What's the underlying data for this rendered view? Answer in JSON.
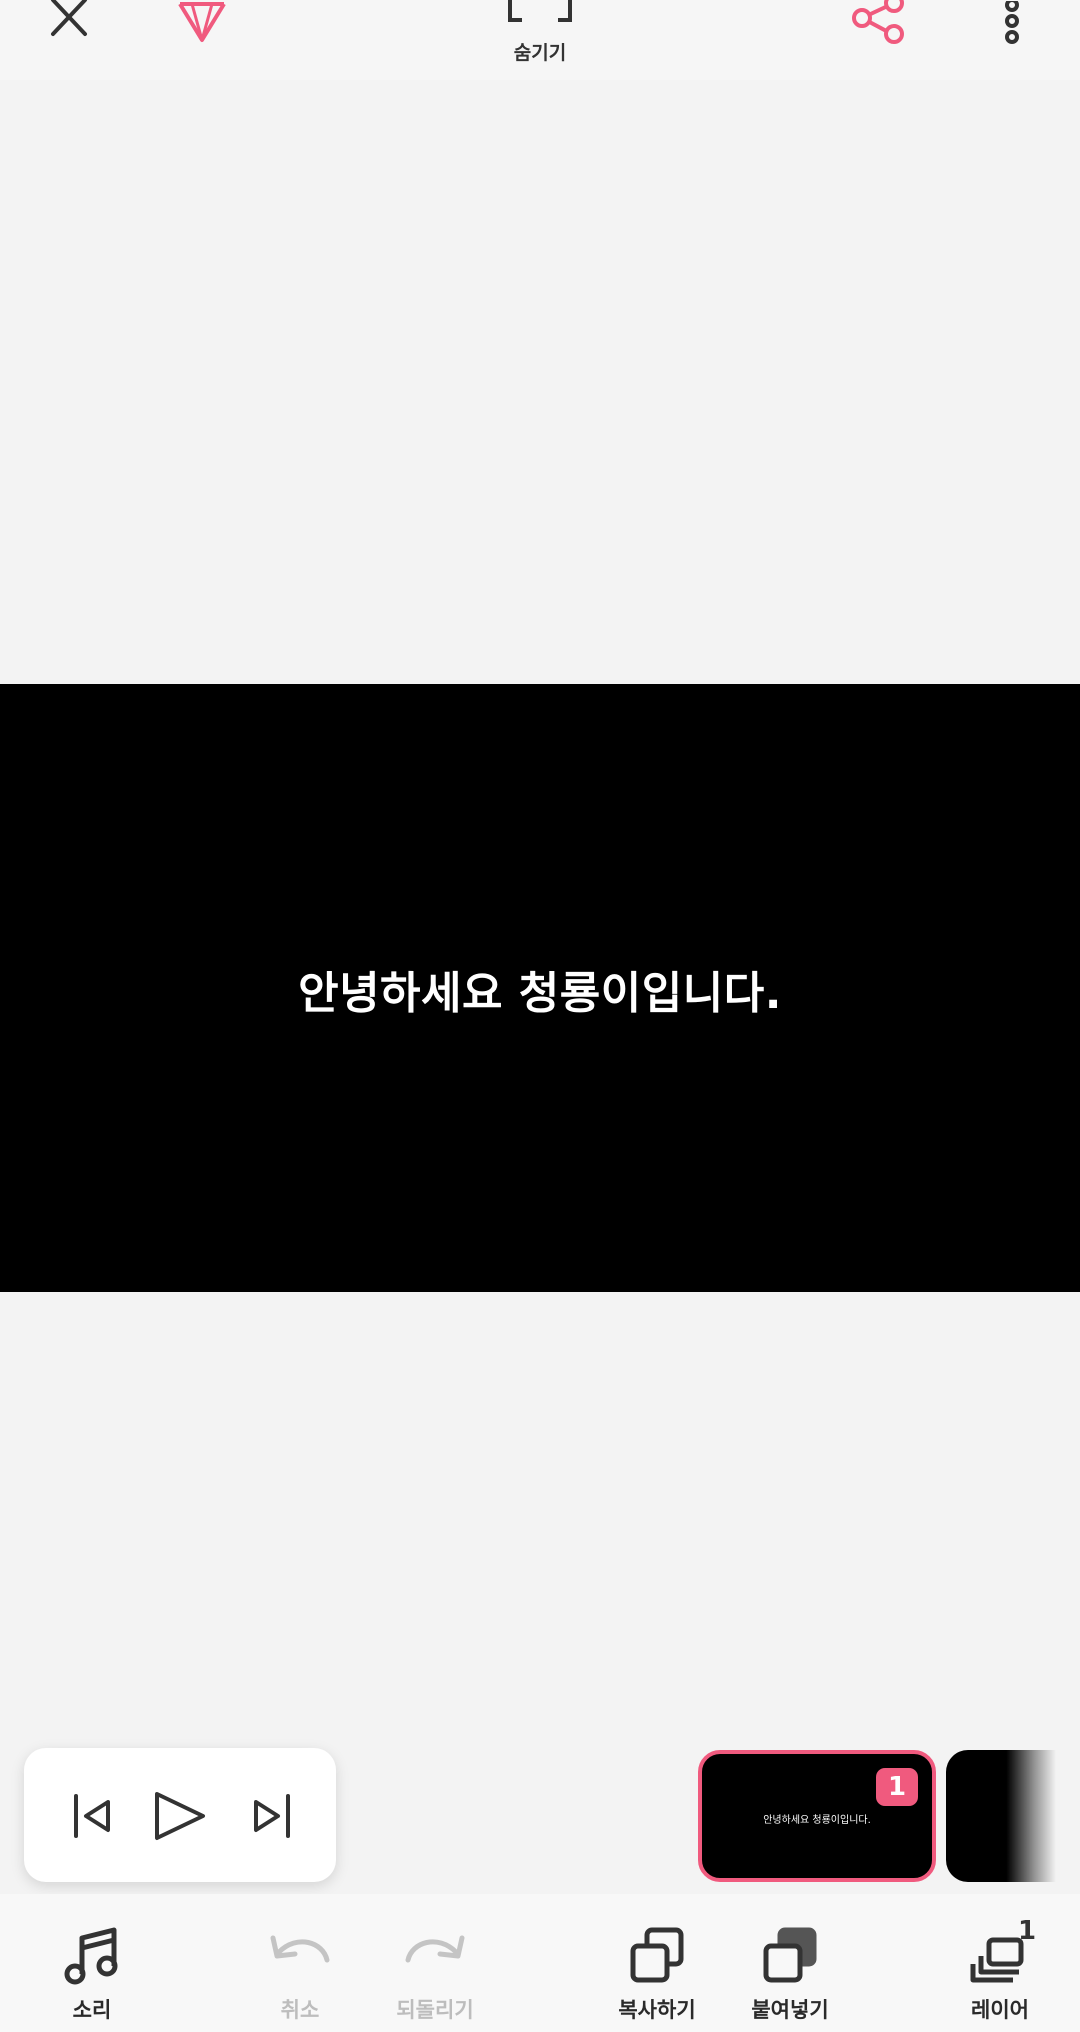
{
  "topbar": {
    "close_icon": "close-icon",
    "premium_icon": "diamond-icon",
    "hide_label": "숨기기",
    "share_icon": "share-icon",
    "more_icon": "more-vertical-icon"
  },
  "canvas": {
    "text": "안녕하세요 청룡이입니다."
  },
  "player": {
    "prev_icon": "skip-previous-icon",
    "play_icon": "play-icon",
    "next_icon": "skip-next-icon"
  },
  "thumbnails": [
    {
      "text": "안녕하세요 청룡이입니다.",
      "badge": "1",
      "selected": true
    },
    {
      "text": "",
      "badge": "",
      "selected": false
    }
  ],
  "bottombar": {
    "sound": "소리",
    "undo": "취소",
    "redo": "되돌리기",
    "copy": "복사하기",
    "paste": "붙여넣기",
    "layer": "레이어",
    "layer_count": "1"
  },
  "colors": {
    "accent": "#f05a7e",
    "canvas": "#000000",
    "background": "#f3f3f3"
  }
}
